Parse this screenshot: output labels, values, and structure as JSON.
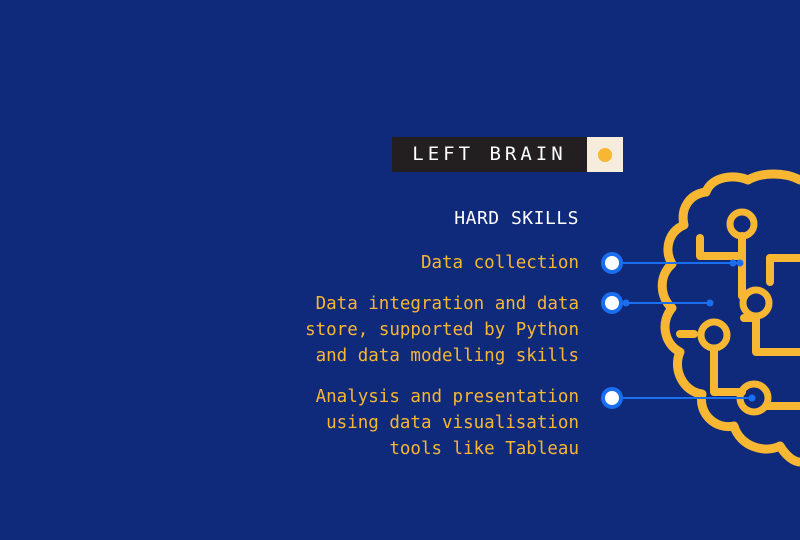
{
  "badge": {
    "label": "LEFT BRAIN"
  },
  "section_heading": "HARD SKILLS",
  "skills": [
    {
      "lines": [
        "Data collection"
      ]
    },
    {
      "lines": [
        "Data integration and data",
        "store, supported by Python",
        "and data modelling skills"
      ]
    },
    {
      "lines": [
        "Analysis and presentation",
        "using data visualisation",
        "tools like Tableau"
      ]
    }
  ],
  "colors": {
    "background": "#0f2a7b",
    "accent_yellow": "#f7b733",
    "connector_blue": "#1a6ff0",
    "badge_dark": "#231f20",
    "badge_light": "#f5ecdc",
    "heading_white": "#ffffff"
  },
  "icons": {
    "badge_icon": "yellow-dot-icon",
    "illustration": "circuit-brain-icon",
    "connector_marker": "ring-node-icon"
  }
}
